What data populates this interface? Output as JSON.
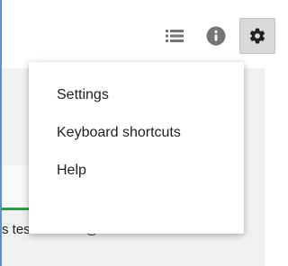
{
  "toolbar": {
    "icons": [
      "list-icon",
      "info-icon",
      "gear-icon"
    ],
    "icon_color": "#757575"
  },
  "menu": {
    "items": [
      {
        "label": "Settings"
      },
      {
        "label": "Keyboard shortcuts"
      },
      {
        "label": "Help"
      }
    ]
  },
  "background": {
    "account_text": "s test.account@northandrew.c"
  },
  "colors": {
    "accent_border": "#5b8fd6",
    "progress_green": "#2e9b45"
  }
}
